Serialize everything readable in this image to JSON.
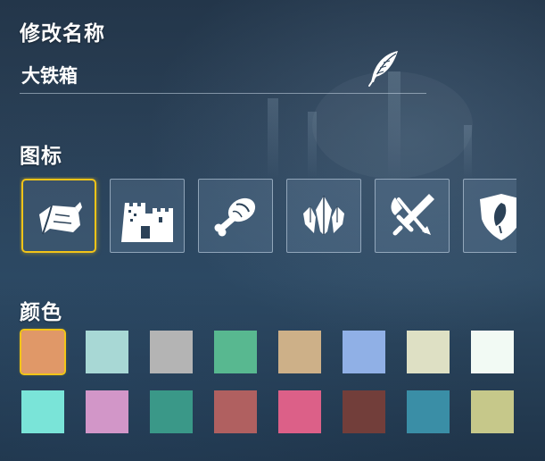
{
  "sections": {
    "rename_title": "修改名称",
    "icon_title": "图标",
    "color_title": "颜色"
  },
  "name_field": {
    "value": "大铁箱",
    "edit_icon": "feather-quill-icon"
  },
  "icons": [
    {
      "name": "wood-log-icon",
      "selected": true
    },
    {
      "name": "castle-icon",
      "selected": false
    },
    {
      "name": "meat-drumstick-icon",
      "selected": false
    },
    {
      "name": "crystal-icon",
      "selected": false
    },
    {
      "name": "crossed-axe-sword-icon",
      "selected": false
    },
    {
      "name": "leaf-shield-icon",
      "selected": false
    }
  ],
  "colors": {
    "row1": [
      "#e09868",
      "#a8d8d5",
      "#b4b4b4",
      "#58b890",
      "#cdb088",
      "#90b0e6",
      "#dee0c4",
      "#f2faf4"
    ],
    "row2": [
      "#7ae4d8",
      "#d296c8",
      "#3a9888",
      "#b06060",
      "#dc6088",
      "#723e3a",
      "#3a8ea6",
      "#c6c88a"
    ],
    "selected_row": 0,
    "selected_index": 0,
    "highlight": "#f2c418"
  }
}
